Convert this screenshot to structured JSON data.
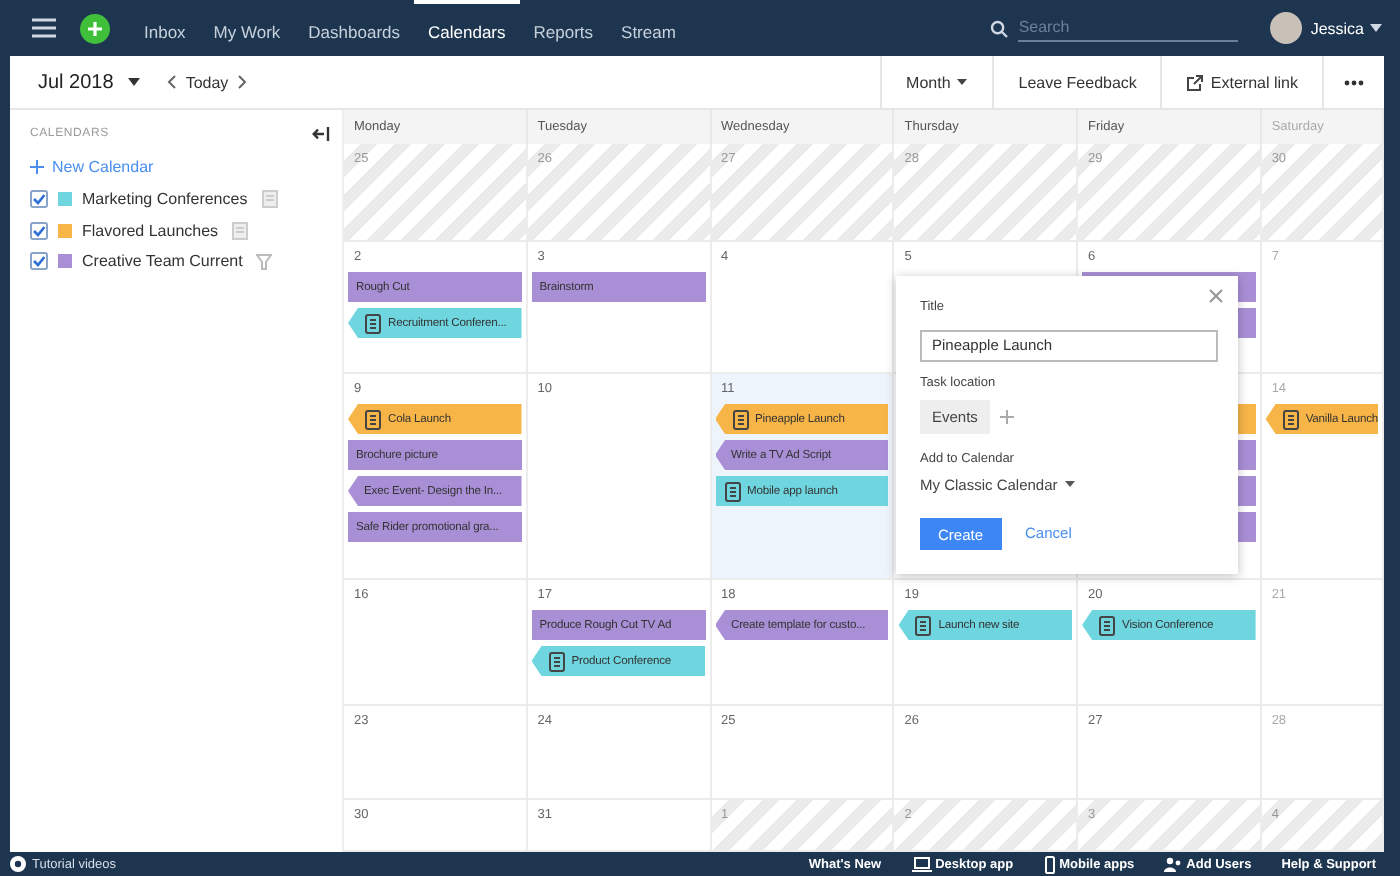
{
  "nav": {
    "items": [
      {
        "label": "Inbox",
        "selected": false
      },
      {
        "label": "My Work",
        "selected": false
      },
      {
        "label": "Dashboards",
        "selected": false
      },
      {
        "label": "Calendars",
        "selected": true
      },
      {
        "label": "Reports",
        "selected": false
      },
      {
        "label": "Stream",
        "selected": false
      }
    ],
    "search": {
      "placeholder": "Search"
    },
    "user": "Jessica"
  },
  "toolbar": {
    "period": "Jul 2018",
    "today": "Today",
    "view": "Month",
    "feedback": "Leave Feedback",
    "external": "External link"
  },
  "sidebar": {
    "heading": "CALENDARS",
    "new_calendar": "New Calendar",
    "calendars": [
      {
        "name": "Marketing Conferences",
        "checked": true,
        "color": "#6fd6e0",
        "kind": "list"
      },
      {
        "name": "Flavored Launches",
        "checked": true,
        "color": "#f7b548",
        "kind": "list"
      },
      {
        "name": "Creative Team Current",
        "checked": true,
        "color": "#a98fd6",
        "kind": "filtered"
      }
    ]
  },
  "calendar": {
    "columns": [
      "Monday",
      "Tuesday",
      "Wednesday",
      "Thursday",
      "Friday",
      "Saturday"
    ],
    "weeks": [
      {
        "days": [
          {
            "date": "25",
            "in_month": false
          },
          {
            "date": "26",
            "in_month": false
          },
          {
            "date": "27",
            "in_month": false
          },
          {
            "date": "28",
            "in_month": false
          },
          {
            "date": "29",
            "in_month": false
          },
          {
            "date": "30",
            "in_month": false
          }
        ]
      },
      {
        "days": [
          {
            "date": "2",
            "in_month": true,
            "events": [
              {
                "title": "Rough Cut",
                "kind": "bar",
                "color": "#a98fd6"
              },
              {
                "title": "Recruitment Conferen...",
                "kind": "flag",
                "icon": true,
                "color": "#6fd6e0"
              }
            ]
          },
          {
            "date": "3",
            "in_month": true,
            "events": [
              {
                "title": "Brainstorm",
                "kind": "bar",
                "color": "#a98fd6"
              }
            ]
          },
          {
            "date": "4",
            "in_month": true
          },
          {
            "date": "5",
            "in_month": true
          },
          {
            "date": "6",
            "in_month": true,
            "events": [
              {
                "kind": "bar",
                "color": "#a98fd6"
              },
              {
                "kind": "bar",
                "color": "#a98fd6"
              }
            ]
          },
          {
            "date": "7",
            "in_month": true
          }
        ]
      },
      {
        "days": [
          {
            "date": "9",
            "in_month": true,
            "events": [
              {
                "title": "Cola Launch",
                "kind": "flag",
                "icon": true,
                "color": "#f7b548"
              },
              {
                "title": "Brochure picture",
                "kind": "bar",
                "color": "#a98fd6"
              },
              {
                "title": "Exec Event- Design the In...",
                "kind": "flag",
                "color": "#a98fd6"
              },
              {
                "title": "Safe Rider promotional gra...",
                "kind": "bar",
                "color": "#a98fd6"
              }
            ]
          },
          {
            "date": "10",
            "in_month": true
          },
          {
            "date": "11",
            "in_month": true,
            "selected": true,
            "events": [
              {
                "title": "Pineapple Launch",
                "kind": "flag",
                "icon": true,
                "color": "#f7b548"
              },
              {
                "title": "Write a TV Ad Script",
                "kind": "flag",
                "color": "#a98fd6"
              },
              {
                "title": "Mobile app launch",
                "kind": "bar",
                "icon": true,
                "color": "#6fd6e0"
              }
            ]
          },
          {
            "in_month": true
          },
          {
            "in_month": true,
            "events": [
              {
                "kind": "bar",
                "color": "#f7b548"
              },
              {
                "kind": "bar",
                "color": "#a98fd6"
              },
              {
                "kind": "bar",
                "color": "#a98fd6"
              },
              {
                "kind": "bar",
                "color": "#a98fd6"
              }
            ]
          },
          {
            "date": "14",
            "in_month": true,
            "events": [
              {
                "title": "Vanilla Launch",
                "kind": "flag",
                "icon": true,
                "color": "#f7b548"
              }
            ]
          }
        ]
      },
      {
        "days": [
          {
            "date": "16",
            "in_month": true
          },
          {
            "date": "17",
            "in_month": true,
            "events": [
              {
                "title": "Produce Rough Cut TV Ad",
                "kind": "bar",
                "color": "#a98fd6"
              },
              {
                "title": "Product Conference",
                "kind": "flag",
                "icon": true,
                "color": "#6fd6e0"
              }
            ]
          },
          {
            "date": "18",
            "in_month": true,
            "events": [
              {
                "title": "Create template for custo...",
                "kind": "flag",
                "color": "#a98fd6"
              }
            ]
          },
          {
            "date": "19",
            "in_month": true,
            "events": [
              {
                "title": "Launch new site",
                "kind": "flag",
                "icon": true,
                "color": "#6fd6e0"
              }
            ]
          },
          {
            "date": "20",
            "in_month": true,
            "events": [
              {
                "title": "Vision Conference",
                "kind": "flag",
                "icon": true,
                "color": "#6fd6e0"
              }
            ]
          },
          {
            "date": "21",
            "in_month": true
          }
        ]
      },
      {
        "days": [
          {
            "date": "23",
            "in_month": true
          },
          {
            "date": "24",
            "in_month": true
          },
          {
            "date": "25",
            "in_month": true
          },
          {
            "date": "26",
            "in_month": true
          },
          {
            "date": "27",
            "in_month": true
          },
          {
            "date": "28",
            "in_month": true
          }
        ]
      },
      {
        "days": [
          {
            "date": "30",
            "in_month": true
          },
          {
            "date": "31",
            "in_month": true
          },
          {
            "date": "1",
            "in_month": false
          },
          {
            "date": "2",
            "in_month": false
          },
          {
            "date": "3",
            "in_month": false
          },
          {
            "date": "4",
            "in_month": false
          }
        ]
      }
    ]
  },
  "popup": {
    "title_label": "Title",
    "title_value": "Pineapple Launch",
    "location_label": "Task location",
    "location": "Events",
    "calendar_label": "Add to Calendar",
    "calendar": "My Classic Calendar",
    "create": "Create",
    "cancel": "Cancel"
  },
  "footer": {
    "tutorial": "Tutorial videos",
    "links": [
      {
        "label": "What's New",
        "kind": "plain"
      },
      {
        "label": "Desktop app",
        "kind": "laptop"
      },
      {
        "label": "Mobile apps",
        "kind": "phone"
      },
      {
        "label": "Add Users",
        "kind": "users"
      },
      {
        "label": "Help & Support",
        "kind": "plain"
      }
    ]
  }
}
